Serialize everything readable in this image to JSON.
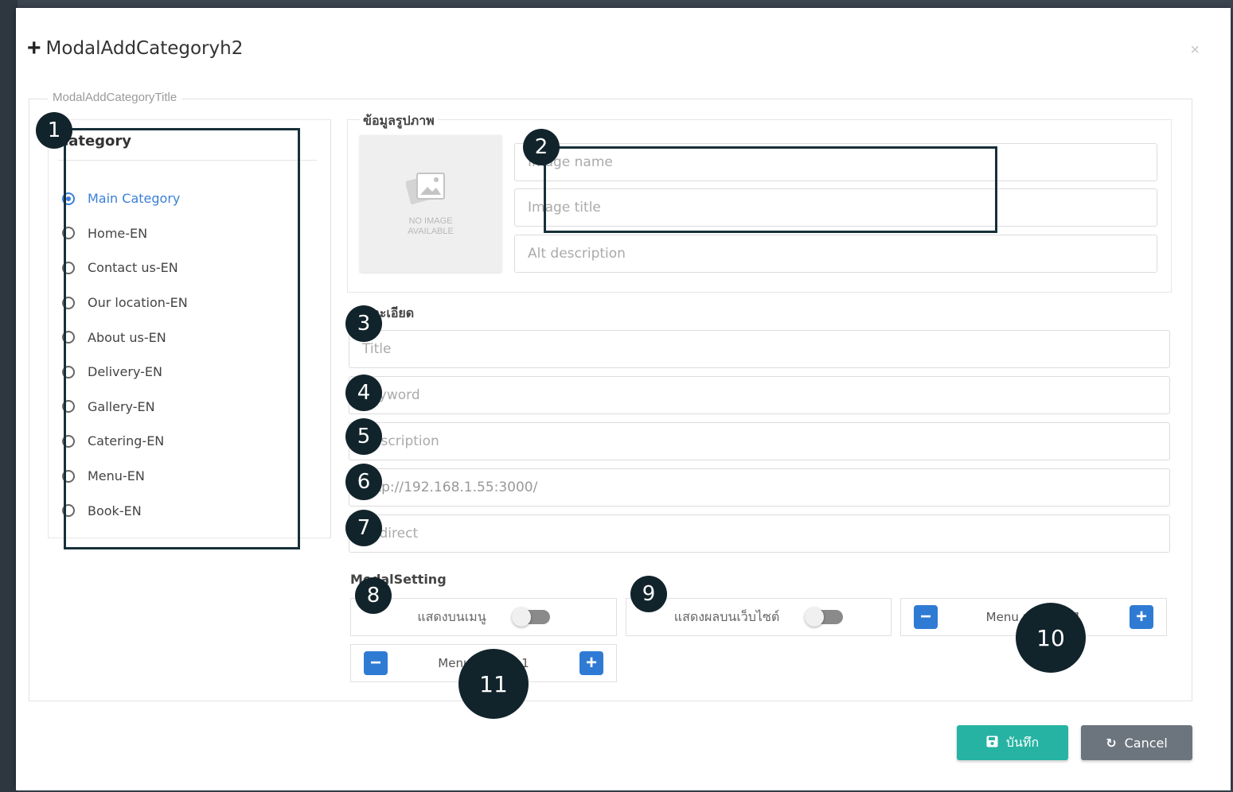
{
  "modal": {
    "title": "ModalAddCategoryh2",
    "plus_icon": "plus-icon",
    "close_symbol": "×"
  },
  "form": {
    "legend": "ModalAddCategoryTitle"
  },
  "category": {
    "heading": "Category",
    "options": [
      {
        "label": "Main Category",
        "selected": true
      },
      {
        "label": "Home-EN",
        "selected": false
      },
      {
        "label": "Contact us-EN",
        "selected": false
      },
      {
        "label": "Our location-EN",
        "selected": false
      },
      {
        "label": "About us-EN",
        "selected": false
      },
      {
        "label": "Delivery-EN",
        "selected": false
      },
      {
        "label": "Gallery-EN",
        "selected": false
      },
      {
        "label": "Catering-EN",
        "selected": false
      },
      {
        "label": "Menu-EN",
        "selected": false
      },
      {
        "label": "Book-EN",
        "selected": false
      }
    ]
  },
  "image_info": {
    "legend": "ข้อมูลรูปภาพ",
    "placeholder_text_1": "NO IMAGE",
    "placeholder_text_2": "AVAILABLE",
    "image_name_placeholder": "Image name",
    "image_title_placeholder": "Image title",
    "alt_placeholder": "Alt description"
  },
  "details": {
    "legend": "รายละเอียด",
    "title_placeholder": "Title",
    "keyword_placeholder": "Keyword",
    "description_placeholder": "Description",
    "url_value": "http://192.168.1.55:3000/",
    "redirect_placeholder": "Redirect"
  },
  "settings": {
    "legend": "ModalSetting",
    "show_menu_label": "แสดงบนเมนู",
    "show_menu_on": false,
    "show_website_label": "แสดงผลบนเว็บไซต์",
    "show_website_on": false,
    "menu_position_label": "Menu position 1",
    "priority_label": "Menu priority 1",
    "minus": "−",
    "plus": "+"
  },
  "buttons": {
    "save_label": "บันทึก",
    "cancel_label": "Cancel",
    "save_color": "#26b3a3",
    "cancel_color": "#6c757d"
  },
  "annotations": [
    "1",
    "2",
    "3",
    "4",
    "5",
    "6",
    "7",
    "8",
    "9",
    "10",
    "11"
  ],
  "colors": {
    "accent": "#3a7fd6",
    "annotation": "#12242b"
  }
}
